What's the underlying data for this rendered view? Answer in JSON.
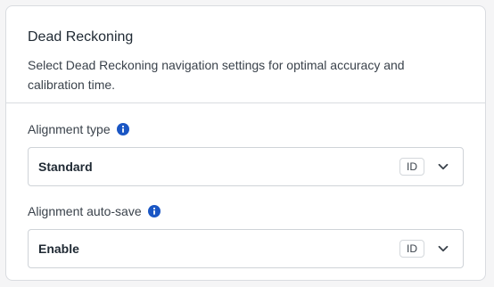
{
  "panel": {
    "title": "Dead Reckoning",
    "description": "Select Dead Reckoning navigation settings for optimal accuracy and calibration time."
  },
  "fields": [
    {
      "label": "Alignment type",
      "info_icon": "info-icon",
      "value": "Standard",
      "badge": "ID",
      "chevron_icon": "chevron-down-icon"
    },
    {
      "label": "Alignment auto-save",
      "info_icon": "info-icon",
      "value": "Enable",
      "badge": "ID",
      "chevron_icon": "chevron-down-icon"
    }
  ],
  "colors": {
    "info_icon": "#1a56c4",
    "border": "#d9dce0",
    "text": "#1f2933"
  }
}
